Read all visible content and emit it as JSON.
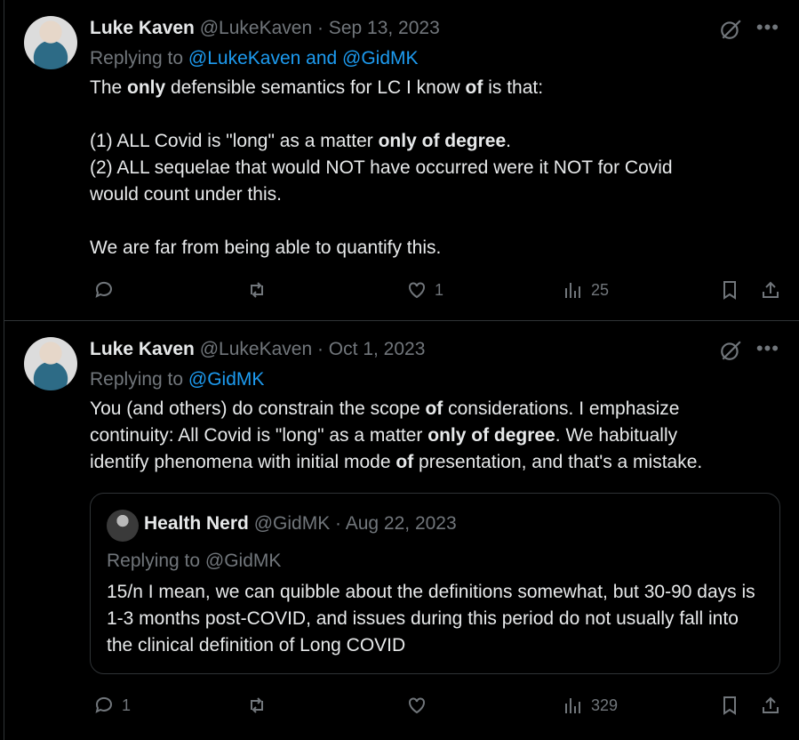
{
  "tweets": [
    {
      "author_name": "Luke Kaven",
      "author_handle": "@LukeKaven",
      "date": "· Sep 13, 2023",
      "replying_prefix": "Replying to",
      "replying_to": "@LukeKaven and @GidMK",
      "body_html": "The <b>only</b> defensible semantics for LC I know <b>of</b> is that:\n\n(1) ALL Covid is \"long\" as a matter <b>only of degree</b>.\n(2) ALL sequelae that would NOT have occurred were it NOT for Covid\nwould count under this.\n\nWe are far from being able to quantify this.",
      "actions": {
        "replies": "",
        "reposts": "",
        "likes": "1",
        "views": "25"
      }
    },
    {
      "author_name": "Luke Kaven",
      "author_handle": "@LukeKaven",
      "date": "· Oct 1, 2023",
      "replying_prefix": "Replying to",
      "replying_to": "@GidMK",
      "body_html": "You (and others) do constrain the scope <b>of</b> considerations.  I emphasize\ncontinuity:  All Covid is \"long\" as a matter <b>only of degree</b>.  We habitually\nidentify phenomena with initial mode <b>of</b> presentation, and that's a mistake.",
      "quote": {
        "author_name": "Health Nerd",
        "author_handle": "@GidMK",
        "date": "· Aug 22, 2023",
        "replying": "Replying to @GidMK",
        "body": "15/n I mean, we can quibble about the definitions somewhat, but 30-90 days is 1-3 months post-COVID, and issues during this period do not usually fall into the clinical definition of Long COVID"
      },
      "actions": {
        "replies": "1",
        "reposts": "",
        "likes": "",
        "views": "329"
      }
    }
  ],
  "icons": {
    "reply": "reply-icon",
    "repost": "repost-icon",
    "like": "heart-icon",
    "views": "views-icon",
    "bookmark": "bookmark-icon",
    "share": "share-icon",
    "grok": "grok-icon",
    "more": "more-icon"
  },
  "colors": {
    "link": "#1d9bf0",
    "muted": "#71767b",
    "text": "#e7e9ea",
    "background": "#000000"
  }
}
